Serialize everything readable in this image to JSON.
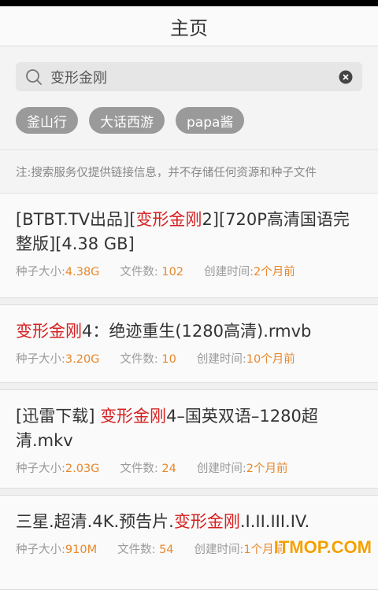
{
  "header": {
    "title": "主页"
  },
  "search": {
    "query": "变形金刚"
  },
  "tags": [
    "釜山行",
    "大话西游",
    "papa酱"
  ],
  "notice": "注:搜索服务仅提供链接信息，并不存储任何资源和种子文件",
  "labels": {
    "size": "种子大小:",
    "files": "文件数: ",
    "created": "创建时间:"
  },
  "results": [
    {
      "title_pre": "[BTBT.TV出品][",
      "title_hl": "变形金刚",
      "title_post": "2][720P高清国语完整版][4.38 GB]",
      "size": "4.38G",
      "files": "102",
      "created": "2个月前"
    },
    {
      "title_pre": "",
      "title_hl": "变形金刚",
      "title_post": "4：绝迹重生(1280高清).rmvb",
      "size": "3.20G",
      "files": "10",
      "created": "10个月前"
    },
    {
      "title_pre": "[迅雷下载] ",
      "title_hl": "变形金刚",
      "title_post": "4–国英双语–1280超清.mkv",
      "size": "2.03G",
      "files": "24",
      "created": "2个月前"
    },
    {
      "title_pre": "三星.超清.4K.预告片.",
      "title_hl": "变形金刚",
      "title_post": ".I.II.III.IV.",
      "size": "910M",
      "files": "54",
      "created": "1个月前"
    }
  ],
  "watermark": "ITMOP.COM",
  "colors": {
    "highlight": "#d62020",
    "value": "#e8872b",
    "tag_bg": "#9a9a9a"
  }
}
